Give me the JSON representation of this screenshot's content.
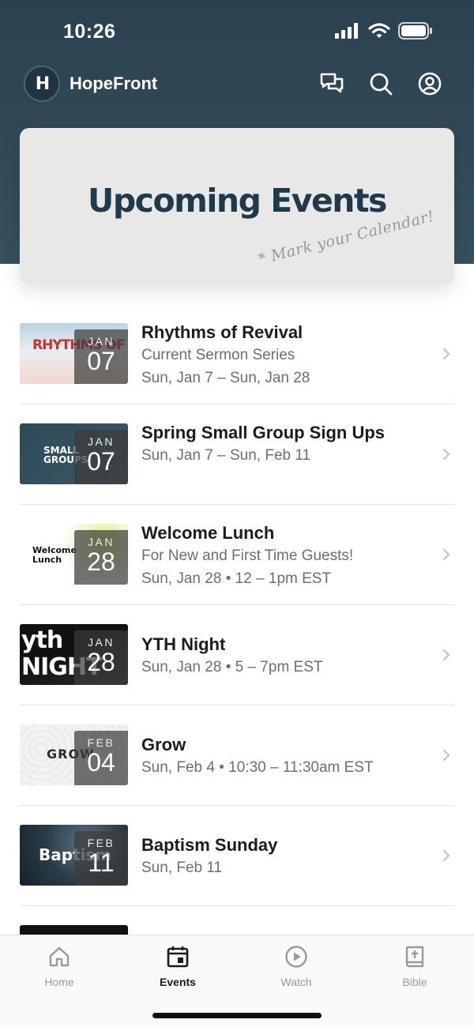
{
  "status_bar": {
    "time": "10:26"
  },
  "app_bar": {
    "title": "HopeFront",
    "logo_text": "H"
  },
  "banner": {
    "title": "Upcoming Events",
    "script": "* Mark your Calendar!"
  },
  "events": [
    {
      "title": "Rhythms of Revival",
      "lines": [
        "Current Sermon Series",
        "Sun, Jan 7 – Sun, Jan 28"
      ],
      "month": "JAN",
      "day": "07",
      "thumb_text": "RHYTHMS OF"
    },
    {
      "title": "Spring Small Group Sign Ups",
      "lines": [
        "Sun, Jan 7 – Sun, Feb 11"
      ],
      "month": "JAN",
      "day": "07",
      "thumb_text": "SMALL GROUPS"
    },
    {
      "title": "Welcome Lunch",
      "lines": [
        "For New and First Time Guests!",
        "Sun, Jan 28 • 12 – 1pm EST"
      ],
      "month": "JAN",
      "day": "28",
      "thumb_text": "Welcome Lunch"
    },
    {
      "title": "YTH Night",
      "lines": [
        "Sun, Jan 28 • 5 – 7pm EST"
      ],
      "month": "JAN",
      "day": "28",
      "thumb_text": "yth NIGHT"
    },
    {
      "title": "Grow",
      "lines": [
        "Sun, Feb 4 • 10:30 – 11:30am EST"
      ],
      "month": "FEB",
      "day": "04",
      "thumb_text": "GROW"
    },
    {
      "title": "Baptism Sunday",
      "lines": [
        "Sun, Feb 11"
      ],
      "month": "FEB",
      "day": "11",
      "thumb_text": "Baptism"
    }
  ],
  "tabs": [
    {
      "label": "Home",
      "icon": "home-icon"
    },
    {
      "label": "Events",
      "icon": "calendar-icon"
    },
    {
      "label": "Watch",
      "icon": "play-icon"
    },
    {
      "label": "Bible",
      "icon": "bible-icon"
    }
  ],
  "colors": {
    "header": "#2f4653",
    "banner_title": "#1e3a4c",
    "active_tab": "#1c1c1e",
    "inactive_tab": "#9a9a9e"
  }
}
